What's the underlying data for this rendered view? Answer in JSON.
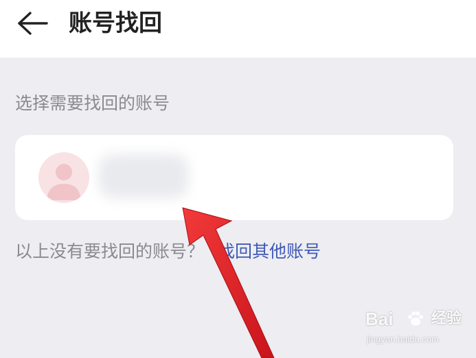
{
  "header": {
    "back_icon": "arrow-left-icon",
    "title": "账号找回"
  },
  "section": {
    "label": "选择需要找回的账号"
  },
  "account": {
    "avatar_icon": "user-avatar-icon",
    "name": "",
    "avatar_color": "#f8e2e4"
  },
  "footer": {
    "question": "以上没有要找回的账号？",
    "link": "找回其他账号"
  },
  "watermark": {
    "brand": "Bai",
    "jingyan": "经验",
    "url": "jingyan.baidu.com"
  },
  "colors": {
    "background": "#ededf2",
    "header": "#ffffff",
    "link": "#3f59b5",
    "muted_text": "#8a8a8f",
    "arrow": "#e3262a"
  }
}
